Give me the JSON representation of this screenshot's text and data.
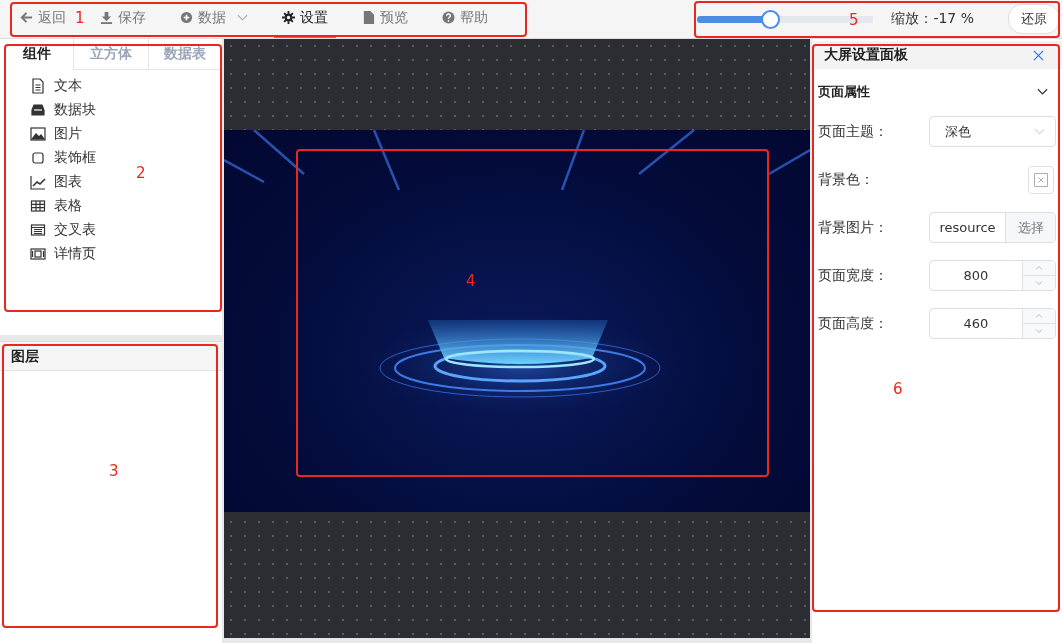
{
  "toolbar": {
    "items": [
      {
        "label": "返回",
        "selected": false,
        "dropdown": false
      },
      {
        "label": "保存",
        "selected": false,
        "dropdown": false
      },
      {
        "label": "数据",
        "selected": false,
        "dropdown": true
      },
      {
        "label": "设置",
        "selected": true,
        "dropdown": false
      },
      {
        "label": "预览",
        "selected": false,
        "dropdown": false
      },
      {
        "label": "帮助",
        "selected": false,
        "dropdown": false
      }
    ]
  },
  "zoom": {
    "level": 0.41,
    "label": "缩放：-17 %",
    "reset_button": "还原"
  },
  "components_panel": {
    "tabs": [
      {
        "label": "组件",
        "selected": true
      },
      {
        "label": "立方体",
        "selected": false
      },
      {
        "label": "数据表",
        "selected": false
      }
    ],
    "items": [
      "文本",
      "数据块",
      "图片",
      "装饰框",
      "图表",
      "表格",
      "交叉表",
      "详情页"
    ]
  },
  "layers_panel": {
    "title": "图层"
  },
  "settings_panel": {
    "title": "大屏设置面板",
    "section": {
      "title": "页面属性",
      "expanded": true
    },
    "fields": [
      {
        "kind": "select",
        "label": "页面主题：",
        "value": "深色"
      },
      {
        "kind": "color",
        "label": "背景色："
      },
      {
        "kind": "file",
        "label": "背景图片：",
        "value": "resource",
        "button": "选择"
      },
      {
        "kind": "number",
        "label": "页面宽度：",
        "value": "800"
      },
      {
        "kind": "number",
        "label": "页面高度：",
        "value": "460"
      }
    ]
  },
  "annotations": [
    {
      "label": "1"
    },
    {
      "label": "2"
    },
    {
      "label": "3"
    },
    {
      "label": "4"
    },
    {
      "label": "5"
    },
    {
      "label": "6"
    }
  ]
}
